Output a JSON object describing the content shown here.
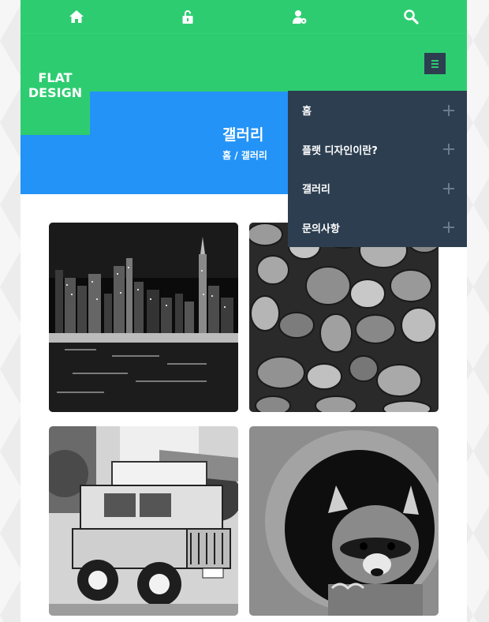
{
  "topbar": {
    "icons": [
      "home-icon",
      "unlock-icon",
      "user-settings-icon",
      "search-icon"
    ]
  },
  "logo": {
    "text": "FLAT\nDESIGN"
  },
  "banner": {
    "title": "갤러리",
    "breadcrumb": "홈 / 갤러리"
  },
  "menu": {
    "icon": "hamburger-menu-icon",
    "items": [
      {
        "label": "홈"
      },
      {
        "label": "플랫 디자인이란?"
      },
      {
        "label": "갤러리"
      },
      {
        "label": "문의사항"
      }
    ]
  },
  "gallery": {
    "photos": [
      {
        "subject": "city-skyline-night"
      },
      {
        "subject": "pebble-stones"
      },
      {
        "subject": "jeep-cafe"
      },
      {
        "subject": "raccoon"
      }
    ]
  },
  "colors": {
    "green": "#2ecc71",
    "blue": "#2393f7",
    "navy": "#2c3e50",
    "white": "#ffffff"
  }
}
